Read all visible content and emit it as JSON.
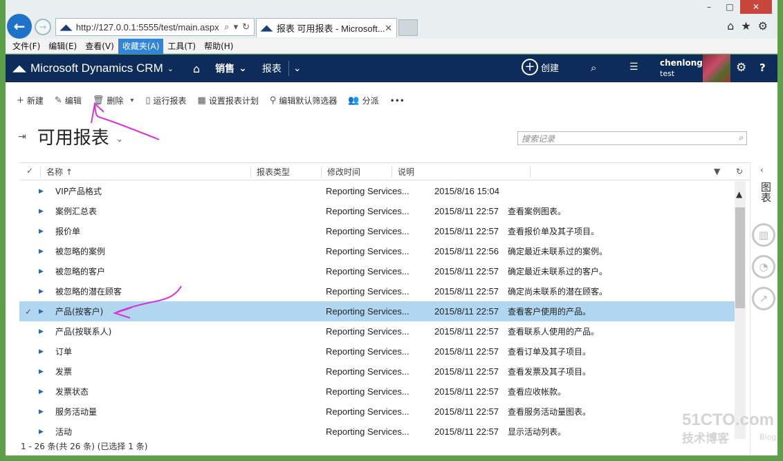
{
  "browser": {
    "url": "http://127.0.0.1:5555/test/main.aspx",
    "tab_title": "报表 可用报表 - Microsoft...",
    "menu": [
      "文件(F)",
      "编辑(E)",
      "查看(V)",
      "收藏夹(A)",
      "工具(T)",
      "帮助(H)"
    ],
    "active_menu_index": 3
  },
  "crm": {
    "brand": "Microsoft Dynamics CRM",
    "nav_sales": "销售",
    "nav_reports": "报表",
    "create_label": "创建",
    "user_name": "chenlong",
    "org_name": "test"
  },
  "commands": {
    "new": "新建",
    "edit": "编辑",
    "delete": "删除",
    "run_report": "运行报表",
    "schedule": "设置报表计划",
    "edit_filter": "编辑默认筛选器",
    "share": "分派",
    "more": "•••"
  },
  "view": {
    "title": "可用报表",
    "search_placeholder": "搜索记录"
  },
  "grid": {
    "headers": {
      "name": "名称 ↑",
      "type": "报表类型",
      "modified": "修改时间",
      "desc": "说明"
    },
    "rows": [
      {
        "name": "VIP产品格式",
        "type": "Reporting Services...",
        "time": "2015/8/16 15:04",
        "desc": ""
      },
      {
        "name": "案例汇总表",
        "type": "Reporting Services...",
        "time": "2015/8/11 22:57",
        "desc": "查看案例图表。"
      },
      {
        "name": "报价单",
        "type": "Reporting Services...",
        "time": "2015/8/11 22:57",
        "desc": "查看报价单及其子项目。"
      },
      {
        "name": "被忽略的案例",
        "type": "Reporting Services...",
        "time": "2015/8/11 22:56",
        "desc": "确定最近未联系过的案例。"
      },
      {
        "name": "被忽略的客户",
        "type": "Reporting Services...",
        "time": "2015/8/11 22:57",
        "desc": "确定最近未联系过的客户。"
      },
      {
        "name": "被忽略的潜在顾客",
        "type": "Reporting Services...",
        "time": "2015/8/11 22:57",
        "desc": "确定尚未联系的潜在顾客。"
      },
      {
        "name": "产品(按客户)",
        "type": "Reporting Services...",
        "time": "2015/8/11 22:57",
        "desc": "查看客户使用的产品。",
        "selected": true
      },
      {
        "name": "产品(按联系人)",
        "type": "Reporting Services...",
        "time": "2015/8/11 22:57",
        "desc": "查看联系人使用的产品。"
      },
      {
        "name": "订单",
        "type": "Reporting Services...",
        "time": "2015/8/11 22:57",
        "desc": "查看订单及其子项目。"
      },
      {
        "name": "发票",
        "type": "Reporting Services...",
        "time": "2015/8/11 22:57",
        "desc": "查看发票及其子项目。"
      },
      {
        "name": "发票状态",
        "type": "Reporting Services...",
        "time": "2015/8/11 22:57",
        "desc": "查看应收帐款。"
      },
      {
        "name": "服务活动量",
        "type": "Reporting Services...",
        "time": "2015/8/11 22:57",
        "desc": "查看服务活动量图表。"
      },
      {
        "name": "活动",
        "type": "Reporting Services...",
        "time": "2015/8/11 22:57",
        "desc": "显示活动列表。"
      }
    ],
    "status": "1 - 26 条(共 26 条) (已选择 1 条)"
  },
  "rail": {
    "label": "图表"
  },
  "watermark": {
    "site": "51CTO.com",
    "tagline": "技术博客",
    "blog": "Blog"
  },
  "colors": {
    "nav_bg": "#0e2c5a",
    "selected_row": "#b1d6f0",
    "annotation": "#d633d6"
  }
}
